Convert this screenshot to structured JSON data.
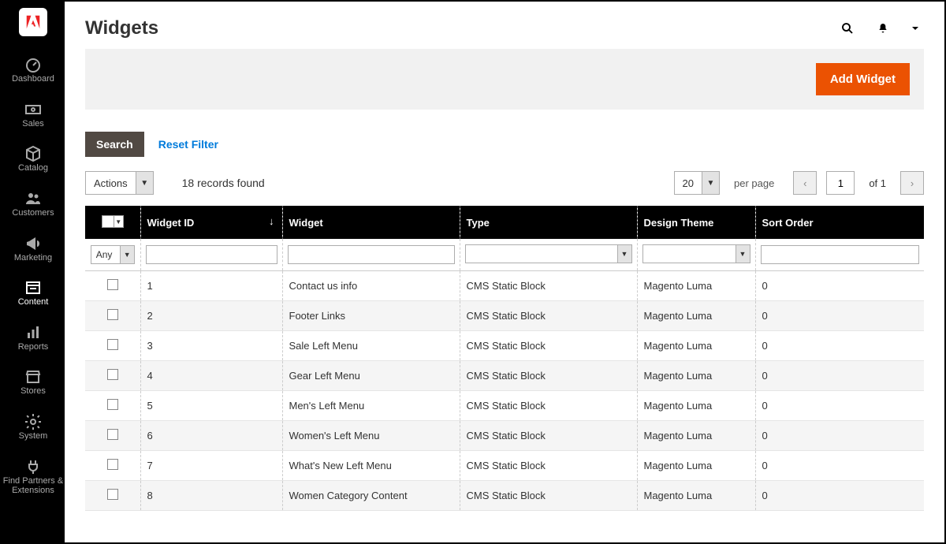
{
  "sidebar": {
    "items": [
      {
        "label": "Dashboard"
      },
      {
        "label": "Sales"
      },
      {
        "label": "Catalog"
      },
      {
        "label": "Customers"
      },
      {
        "label": "Marketing"
      },
      {
        "label": "Content"
      },
      {
        "label": "Reports"
      },
      {
        "label": "Stores"
      },
      {
        "label": "System"
      },
      {
        "label": "Find Partners & Extensions"
      }
    ]
  },
  "page": {
    "title": "Widgets"
  },
  "actions": {
    "add_widget": "Add Widget"
  },
  "filters": {
    "search": "Search",
    "reset": "Reset Filter",
    "actions_label": "Actions",
    "records": "18 records found",
    "per_page_value": "20",
    "per_page_label": "per page",
    "page_value": "1",
    "page_of": "of 1",
    "any_label": "Any"
  },
  "table": {
    "headers": {
      "widget_id": "Widget ID",
      "widget": "Widget",
      "type": "Type",
      "theme": "Design Theme",
      "sort": "Sort Order"
    },
    "rows": [
      {
        "id": "1",
        "widget": "Contact us info",
        "type": "CMS Static Block",
        "theme": "Magento Luma",
        "sort": "0"
      },
      {
        "id": "2",
        "widget": "Footer Links",
        "type": "CMS Static Block",
        "theme": "Magento Luma",
        "sort": "0"
      },
      {
        "id": "3",
        "widget": "Sale Left Menu",
        "type": "CMS Static Block",
        "theme": "Magento Luma",
        "sort": "0"
      },
      {
        "id": "4",
        "widget": "Gear Left Menu",
        "type": "CMS Static Block",
        "theme": "Magento Luma",
        "sort": "0"
      },
      {
        "id": "5",
        "widget": "Men's Left Menu",
        "type": "CMS Static Block",
        "theme": "Magento Luma",
        "sort": "0"
      },
      {
        "id": "6",
        "widget": "Women's Left Menu",
        "type": "CMS Static Block",
        "theme": "Magento Luma",
        "sort": "0"
      },
      {
        "id": "7",
        "widget": "What's New Left Menu",
        "type": "CMS Static Block",
        "theme": "Magento Luma",
        "sort": "0"
      },
      {
        "id": "8",
        "widget": "Women Category Content",
        "type": "CMS Static Block",
        "theme": "Magento Luma",
        "sort": "0"
      }
    ]
  }
}
